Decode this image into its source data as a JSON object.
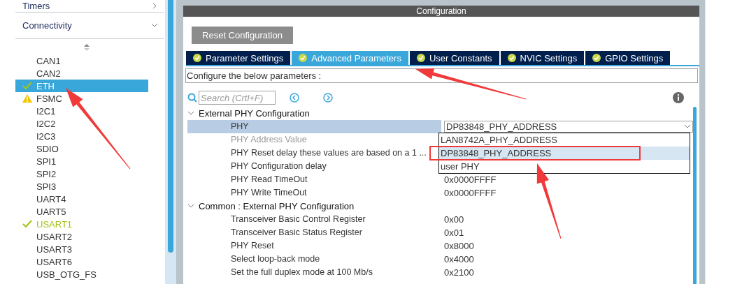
{
  "sidebar": {
    "categories": [
      {
        "label": "Timers",
        "expanded": false
      },
      {
        "label": "Connectivity",
        "expanded": true
      }
    ],
    "items": [
      {
        "label": "CAN1",
        "kind": "plain",
        "selected": false
      },
      {
        "label": "CAN2",
        "kind": "plain",
        "selected": false
      },
      {
        "label": "ETH",
        "kind": "ok",
        "selected": true
      },
      {
        "label": "FSMC",
        "kind": "warning",
        "selected": false
      },
      {
        "label": "I2C1",
        "kind": "plain",
        "selected": false
      },
      {
        "label": "I2C2",
        "kind": "plain",
        "selected": false
      },
      {
        "label": "I2C3",
        "kind": "plain",
        "selected": false
      },
      {
        "label": "SDIO",
        "kind": "plain",
        "selected": false
      },
      {
        "label": "SPI1",
        "kind": "plain",
        "selected": false
      },
      {
        "label": "SPI2",
        "kind": "plain",
        "selected": false
      },
      {
        "label": "SPI3",
        "kind": "plain",
        "selected": false
      },
      {
        "label": "UART4",
        "kind": "plain",
        "selected": false
      },
      {
        "label": "UART5",
        "kind": "plain",
        "selected": false
      },
      {
        "label": "USART1",
        "kind": "ok",
        "selected": false
      },
      {
        "label": "USART2",
        "kind": "plain",
        "selected": false
      },
      {
        "label": "USART3",
        "kind": "plain",
        "selected": false
      },
      {
        "label": "USART6",
        "kind": "plain",
        "selected": false
      },
      {
        "label": "USB_OTG_FS",
        "kind": "plain",
        "selected": false
      }
    ]
  },
  "config": {
    "title": "Configuration",
    "reset_button": "Reset Configuration",
    "tabs": [
      {
        "label": "Parameter Settings",
        "selected": false
      },
      {
        "label": "Advanced Parameters",
        "selected": true
      },
      {
        "label": "User Constants",
        "selected": false
      },
      {
        "label": "NVIC Settings",
        "selected": false
      },
      {
        "label": "GPIO Settings",
        "selected": false
      }
    ],
    "description": "Configure the below parameters :",
    "search": {
      "placeholder": "Search (Crtl+F)"
    },
    "groups": [
      {
        "title": "External PHY Configuration",
        "expanded": true,
        "rows": [
          {
            "label": "PHY",
            "kind": "select",
            "value": "DP83848_PHY_ADDRESS",
            "selected": true,
            "disabled": false
          },
          {
            "label": "PHY Address Value",
            "selected": false,
            "disabled": true
          },
          {
            "label": "PHY Reset delay these values are based on a 1 ...",
            "selected": false,
            "disabled": false
          },
          {
            "label": "PHY Configuration delay",
            "selected": false,
            "disabled": false
          },
          {
            "label": "PHY Read TimeOut",
            "kind": "text",
            "value": "0x0000FFFF",
            "selected": false,
            "disabled": false
          },
          {
            "label": "PHY Write TimeOut",
            "kind": "text",
            "value": "0x0000FFFF",
            "selected": false,
            "disabled": false
          }
        ]
      },
      {
        "title": "Common : External PHY Configuration",
        "expanded": true,
        "rows": [
          {
            "label": "Transceiver Basic Control Register",
            "kind": "text",
            "value": "0x00",
            "selected": false,
            "disabled": false
          },
          {
            "label": "Transceiver Basic Status Register",
            "kind": "text",
            "value": "0x01",
            "selected": false,
            "disabled": false
          },
          {
            "label": "PHY Reset",
            "kind": "text",
            "value": "0x8000",
            "selected": false,
            "disabled": false
          },
          {
            "label": "Select loop-back mode",
            "kind": "text",
            "value": "0x4000",
            "selected": false,
            "disabled": false
          },
          {
            "label": "Set the full duplex mode at 100 Mb/s",
            "kind": "text",
            "value": "0x2100",
            "selected": false,
            "disabled": false
          }
        ]
      }
    ],
    "dropdown": {
      "options": [
        {
          "label": "LAN8742A_PHY_ADDRESS",
          "selected": false
        },
        {
          "label": "DP83848_PHY_ADDRESS",
          "selected": true
        },
        {
          "label": "user PHY",
          "selected": false
        }
      ]
    }
  }
}
